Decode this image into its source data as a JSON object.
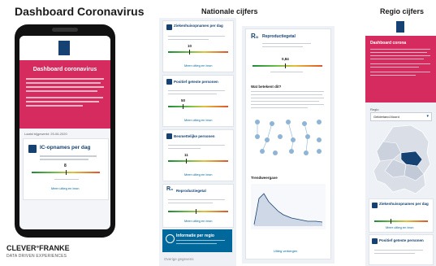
{
  "headers": {
    "left_title": "Dashboard Coronavirus",
    "middle_title": "Nationale cijfers",
    "right_title": "Regio cijfers"
  },
  "branding": {
    "logo": "CLEVER°FRANKE",
    "tagline": "DATA DRIVEN EXPERIENCES"
  },
  "phone": {
    "hero_title": "Dashboard coronavirus",
    "updated": "Laatst bijgewerkt: 25-06-2020",
    "card_title": "IC-opnames per dag",
    "card_value": "8",
    "card_link": "Meer uitleg en bron"
  },
  "national_left": {
    "cards": [
      {
        "title": "Ziekenhuisopnames per dag",
        "value": "10"
      },
      {
        "title": "Positief geteste personen",
        "value": "50"
      },
      {
        "title": "Besmettelijke personen",
        "value": "11"
      },
      {
        "title": "Reproductiegetal",
        "value": "0,84"
      }
    ],
    "info_card": "Informatie per regio",
    "overige": "Overige gegevens",
    "link": "Meer uitleg en bron"
  },
  "national_right": {
    "title": "Reproductiegetal",
    "value": "0,84",
    "subtitle": "Wat betekent dit?",
    "trend_title": "Trendweergave",
    "link": "Uitleg verbergen"
  },
  "regio": {
    "hero_title": "Dashboard corona",
    "select_label": "Regio",
    "select_value": "Gelderland-Noord",
    "card1_title": "Ziekenhuisopnames per dag",
    "card2_title": "Positief geteste personen",
    "link": "Meer uitleg en bron"
  },
  "colors": {
    "brand_pink": "#d52b5e",
    "brand_blue": "#154273",
    "accent_blue": "#01689b"
  }
}
